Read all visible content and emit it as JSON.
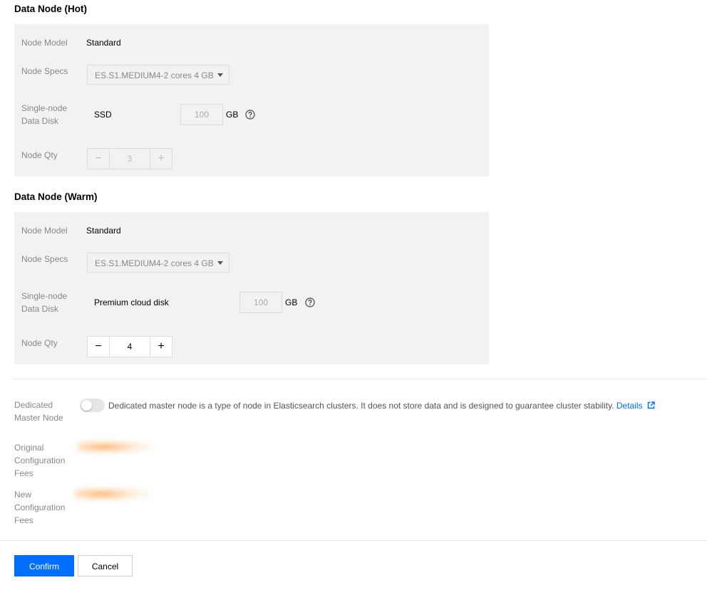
{
  "hot": {
    "title": "Data Node (Hot)",
    "node_model_label": "Node Model",
    "node_model_value": "Standard",
    "node_specs_label": "Node Specs",
    "node_specs_value": "ES.S1.MEDIUM4-2 cores 4 GB",
    "disk_label_line1": "Single-node",
    "disk_label_line2": "Data Disk",
    "disk_type": "SSD",
    "disk_size": "100",
    "disk_unit": "GB",
    "qty_label": "Node Qty",
    "qty_value": "3",
    "qty_minus": "−",
    "qty_plus": "+"
  },
  "warm": {
    "title": "Data Node (Warm)",
    "node_model_label": "Node Model",
    "node_model_value": "Standard",
    "node_specs_label": "Node Specs",
    "node_specs_value": "ES.S1.MEDIUM4-2 cores 4 GB",
    "disk_label_line1": "Single-node",
    "disk_label_line2": "Data Disk",
    "disk_type": "Premium cloud disk",
    "disk_size": "100",
    "disk_unit": "GB",
    "qty_label": "Node Qty",
    "qty_value": "4",
    "qty_minus": "−",
    "qty_plus": "+"
  },
  "master": {
    "label_line1": "Dedicated",
    "label_line2": "Master Node",
    "enabled": false,
    "description": "Dedicated master node is a type of node in Elasticsearch clusters. It does not store data and is designed to guarantee cluster stability.",
    "details_link": "Details"
  },
  "fees": {
    "original_line1": "Original",
    "original_line2": "Configuration",
    "original_line3": "Fees",
    "new_line1": "New",
    "new_line2": "Configuration",
    "new_line3": "Fees"
  },
  "actions": {
    "confirm": "Confirm",
    "cancel": "Cancel"
  },
  "colors": {
    "primary": "#006eff",
    "panel_bg": "#f2f2f2"
  }
}
